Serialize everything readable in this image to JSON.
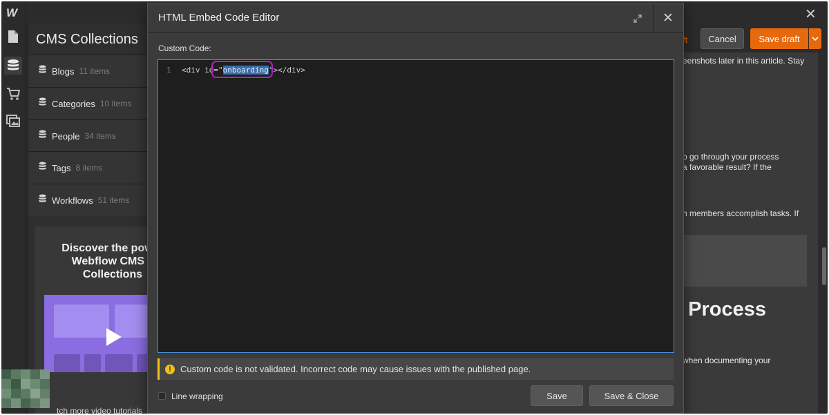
{
  "app": {
    "logo": "W"
  },
  "rail": {
    "icons": [
      "pages-icon",
      "cms-database-icon",
      "ecommerce-cart-icon",
      "assets-icon"
    ]
  },
  "cms": {
    "title": "CMS Collections",
    "collections": [
      {
        "name": "Blogs",
        "count": "11 items"
      },
      {
        "name": "Categories",
        "count": "10 items"
      },
      {
        "name": "People",
        "count": "34 items"
      },
      {
        "name": "Tags",
        "count": "8 items"
      },
      {
        "name": "Workflows",
        "count": "51 items"
      }
    ],
    "promo": {
      "line1": "Discover the power",
      "line2": "Webflow CMS a",
      "line3": "Collections"
    },
    "footnote": "tch more video tutorials"
  },
  "toolbar": {
    "draft_fragment": "ft",
    "cancel_label": "Cancel",
    "save_draft_label": "Save draft"
  },
  "page_content": {
    "line1": "eenshots later in this article. Stay",
    "line2": "o go through your process",
    "line3": "a favorable result? If the",
    "line4": "n members accomplish tasks. If",
    "heading": "l Process",
    "line5": "when documenting your"
  },
  "modal": {
    "title": "HTML Embed Code Editor",
    "label": "Custom Code:",
    "code": {
      "line_number": "1",
      "open": "<div ",
      "attr": "id",
      "eq": "=\"",
      "value": "onboarding",
      "close_quote": "\">",
      "end": "</div>"
    },
    "warning": "Custom code is not validated. Incorrect code may cause issues with the published page.",
    "line_wrapping_label": "Line wrapping",
    "save_label": "Save",
    "save_close_label": "Save & Close"
  },
  "colors": {
    "accent": "#e8680c",
    "warning": "#f2c21b",
    "editor_border": "#4d8fd6",
    "highlight_ring": "#b023b8",
    "promo": "#8a6de0"
  }
}
